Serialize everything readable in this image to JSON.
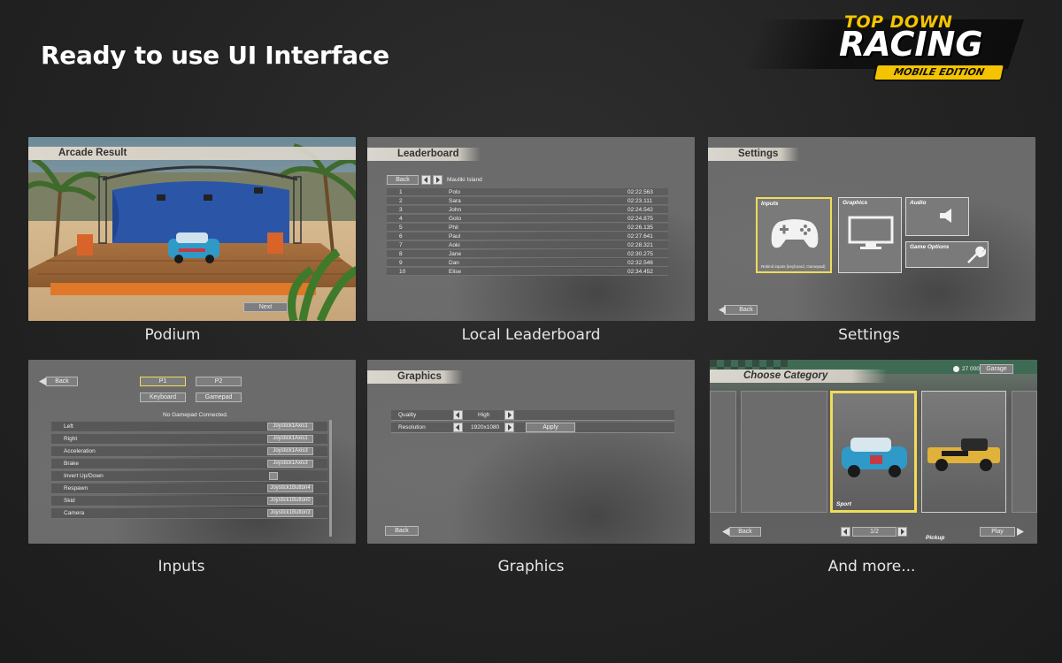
{
  "headline": "Ready to use UI Interface",
  "logo": {
    "line1": "TOP DOWN",
    "line2": "RACING",
    "line3": "MOBILE EDITION"
  },
  "captions": [
    "Podium",
    "Local Leaderboard",
    "Settings",
    "Inputs",
    "Graphics",
    "And more..."
  ],
  "podium": {
    "title": "Arcade Result",
    "next": "Next"
  },
  "leaderboard": {
    "title": "Leaderboard",
    "back": "Back",
    "track": "Mautiki Island",
    "rows": [
      {
        "rank": "1",
        "name": "Polo",
        "time": "02:22.563"
      },
      {
        "rank": "2",
        "name": "Sara",
        "time": "02:23.111"
      },
      {
        "rank": "3",
        "name": "John",
        "time": "02:24.542"
      },
      {
        "rank": "4",
        "name": "Goto",
        "time": "02:24.875"
      },
      {
        "rank": "5",
        "name": "Phil",
        "time": "02:26.135"
      },
      {
        "rank": "6",
        "name": "Paul",
        "time": "02:27.641"
      },
      {
        "rank": "7",
        "name": "Aoki",
        "time": "02:28.321"
      },
      {
        "rank": "8",
        "name": "Jane",
        "time": "02:30.275"
      },
      {
        "rank": "9",
        "name": "Dan",
        "time": "02:32.546"
      },
      {
        "rank": "10",
        "name": "Elise",
        "time": "02:34.452"
      }
    ]
  },
  "settings": {
    "title": "Settings",
    "inputs": "Inputs",
    "inputs_sub": "Rebind inputs (keyboard, Gamepad)",
    "graphics": "Graphics",
    "audio": "Audio",
    "game_options": "Game Options",
    "back": "Back"
  },
  "inputs": {
    "back": "Back",
    "p1": "P1",
    "p2": "P2",
    "keyboard": "Keyboard",
    "gamepad": "Gamepad",
    "status": "No Gamepad Connected.",
    "rows": [
      {
        "label": "Left",
        "value": "Joystick1Axis1"
      },
      {
        "label": "Right",
        "value": "Joystick1Axis1"
      },
      {
        "label": "Acceleration",
        "value": "Joystick1Axis3"
      },
      {
        "label": "Brake",
        "value": "Joystick1Axis3"
      },
      {
        "label": "Invert Up/Down",
        "value": ""
      },
      {
        "label": "Respawn",
        "value": "Joystick1Button4"
      },
      {
        "label": "Skid",
        "value": "Joystick1Button0"
      },
      {
        "label": "Camera",
        "value": "Joystick1Button3"
      }
    ]
  },
  "graphics": {
    "title": "Graphics",
    "quality_label": "Quality",
    "quality_value": "High",
    "resolution_label": "Resolution",
    "resolution_value": "1920x1080",
    "apply": "Apply",
    "back": "Back"
  },
  "category": {
    "title": "Choose Category",
    "coins": "27 000",
    "garage": "Garage",
    "cards": [
      "Sport",
      "Pickup"
    ],
    "page": "1/2",
    "back": "Back",
    "play": "Play"
  },
  "colors": {
    "accent_yellow": "#f5c400",
    "selected_yellow": "#f0dc5a",
    "panel_gray": "#6b6b6b"
  }
}
